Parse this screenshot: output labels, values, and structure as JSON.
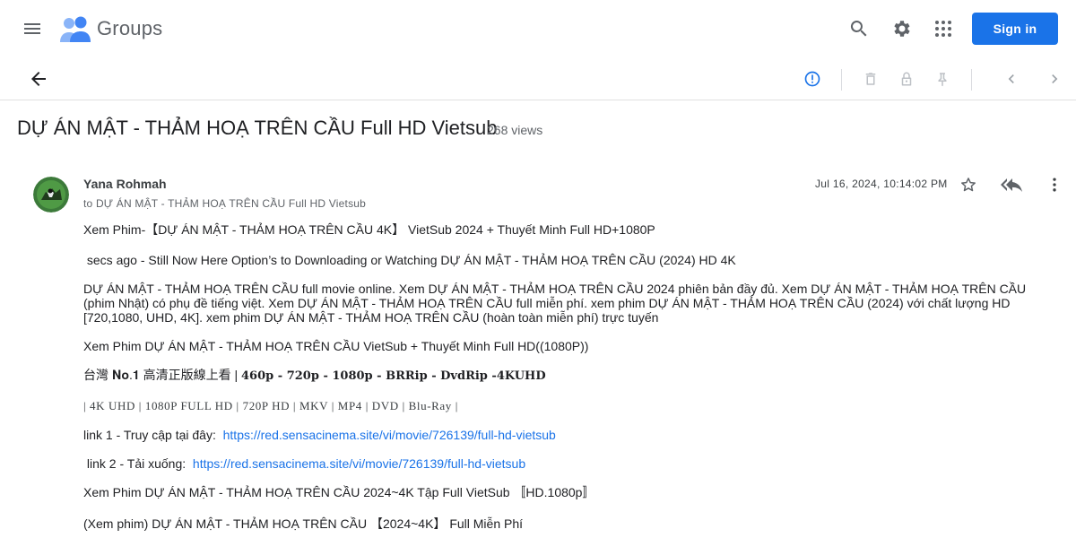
{
  "appbar": {
    "product_name": "Groups",
    "sign_in_label": "Sign in",
    "brand_color": "#1a73e8",
    "icons": [
      "menu-icon",
      "groups-logo-icon",
      "search-icon",
      "settings-gear-icon",
      "apps-grid-icon"
    ]
  },
  "toolbar": {
    "icons": [
      "back-arrow-icon",
      "report-abuse-icon",
      "delete-icon",
      "lock-icon",
      "pin-icon",
      "previous-chevron-icon",
      "next-chevron-icon"
    ]
  },
  "thread": {
    "title": "DỰ ÁN MẬT - THẢM HOẠ TRÊN CẦU Full HD Vietsub",
    "views": "268 views"
  },
  "message": {
    "author": "Yana Rohmah",
    "to_line": "to DỰ ÁN MẬT - THẢM HOẠ TRÊN CẦU Full HD Vietsub",
    "timestamp": "Jul 16, 2024, 10:14:02 PM",
    "icons": [
      "star-icon",
      "reply-all-icon",
      "more-vert-icon"
    ],
    "body": {
      "line1": "Xem Phim-【DỰ ÁN MẬT - THẢM HOẠ TRÊN CẦU 4K】 VietSub 2024 + Thuyết Minh Full HD+1080P",
      "line2": " secs ago - Still Now Here Option’s to Downloading or Watching DỰ ÁN MẬT - THẢM HOẠ TRÊN CẦU (2024) HD 4K",
      "paragraph": "DỰ ÁN MẬT - THẢM HOẠ TRÊN CẦU full movie online. Xem DỰ ÁN MẬT - THẢM HOẠ TRÊN CẦU 2024 phiên bản đầy đủ. Xem DỰ ÁN MẬT - THẢM HOẠ TRÊN CẦU (phim Nhật) có phụ đề tiếng việt. Xem DỰ ÁN MẬT - THẢM HOẠ TRÊN CẦU full miễn phí. xem phim DỰ ÁN MẬT - THẢM HOẠ TRÊN CẦU (2024) với chất lượng HD [720,1080, UHD, 4K]. xem phim DỰ ÁN MẬT - THẢM HOẠ TRÊN CẦU (hoàn toàn miễn phí) trực tuyến",
      "line4": "Xem Phim DỰ ÁN MẬT - THẢM HOẠ TRÊN CẦU VietSub + Thuyết Minh Full HD((1080P))",
      "line5_prefix": "台灣 𝐍𝐨.𝟏 高清正版線上看 | ",
      "line5_bold": "460p - 720p - 1080p - BRRip - DvdRip -4KUHD",
      "line6": "| 4K UHD | 1080P FULL HD | 720P HD | MKV | MP4 | DVD | Blu-Ray |",
      "link1_label": "link 1 - Truy cập tại đây:",
      "link1_url": "https://red.sensacinema.site/vi/movie/726139/full-hd-vietsub",
      "link2_label": " link 2 - Tải xuống:",
      "link2_url": "https://red.sensacinema.site/vi/movie/726139/full-hd-vietsub",
      "line9": "Xem Phim DỰ ÁN MẬT - THẢM HOẠ TRÊN CẦU 2024~4K Tập Full VietSub 〚HD.1080p〛",
      "line10": "(Xem phim) DỰ ÁN MẬT - THẢM HOẠ TRÊN CẦU 【2024~4K】 Full Miễn Phí"
    }
  }
}
